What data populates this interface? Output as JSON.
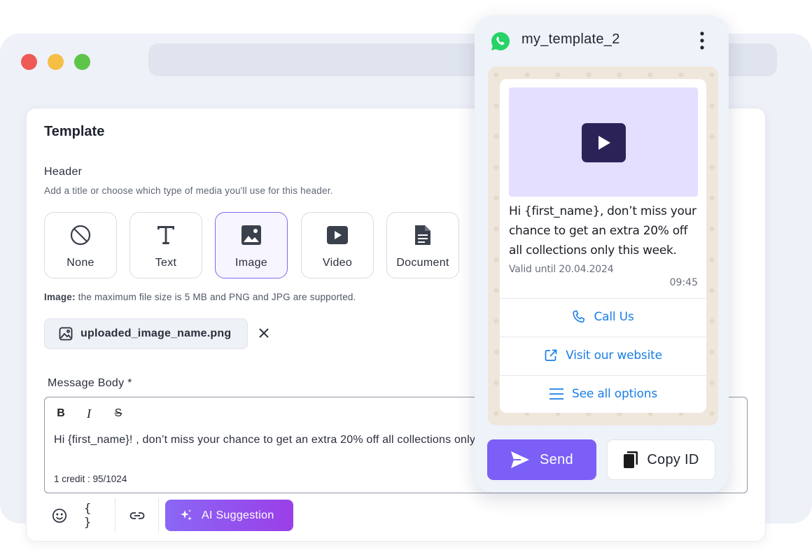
{
  "colors": {
    "accent": "#7b5ff6",
    "selected_border": "#7b6cf6",
    "link_blue": "#1a7ee6",
    "whatsapp_green": "#25d366"
  },
  "template": {
    "title": "Template",
    "header": {
      "label": "Header",
      "help": "Add a title or choose which type of media you'll use for this header.",
      "options": [
        {
          "label": "None",
          "icon": "none-icon",
          "selected": false
        },
        {
          "label": "Text",
          "icon": "text-icon",
          "selected": false
        },
        {
          "label": "Image",
          "icon": "image-icon",
          "selected": true
        },
        {
          "label": "Video",
          "icon": "video-icon",
          "selected": false
        },
        {
          "label": "Document",
          "icon": "document-icon",
          "selected": false
        }
      ],
      "note_bold": "Image:",
      "note_text": " the maximum file size is 5 MB and PNG and JPG are supported.",
      "uploaded_file": "uploaded_image_name.png"
    },
    "body": {
      "label": "Message Body *",
      "formatting": [
        {
          "label": "B",
          "icon": "bold-icon"
        },
        {
          "label": "I",
          "icon": "italic-icon"
        },
        {
          "label": "S",
          "icon": "strikethrough-icon"
        }
      ],
      "text": "Hi {first_name}! , don’t miss your chance to get an extra 20% off all collections only this week.",
      "credit": "1 credit : 95/1024"
    },
    "toolbar": {
      "variables_label": "{ }",
      "ai_label": "AI Suggestion"
    }
  },
  "preview": {
    "template_name": "my_template_2",
    "message": "Hi {first_name}, don’t miss your chance to get an extra 20% off all collections only this week.",
    "valid_until": "Valid until 20.04.2024",
    "time": "09:45",
    "buttons": [
      {
        "label": "Call Us",
        "icon": "phone-icon"
      },
      {
        "label": "Visit our website",
        "icon": "external-link-icon"
      },
      {
        "label": "See all options",
        "icon": "list-icon"
      }
    ],
    "send_label": "Send",
    "copy_label": "Copy ID"
  }
}
